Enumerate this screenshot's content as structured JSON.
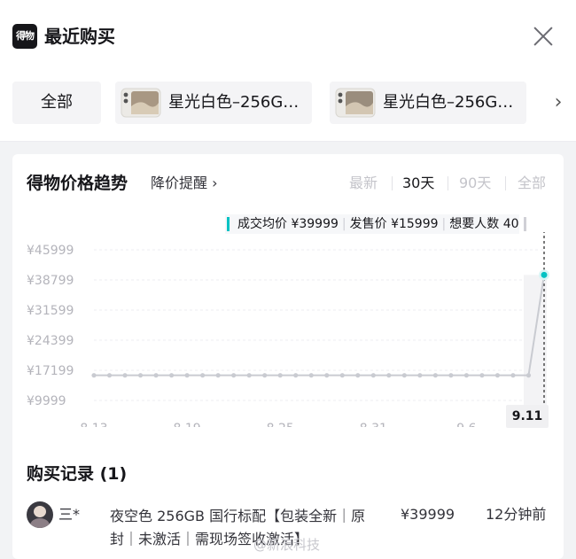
{
  "header": {
    "logo_text": "得物",
    "title": "最近购买"
  },
  "tabs": {
    "all_label": "全部",
    "products": [
      {
        "label": "星光白色–256G…"
      },
      {
        "label": "星光白色–256G…"
      }
    ]
  },
  "trend": {
    "title": "得物价格趋势",
    "price_alert_label": "降价提醒 ›",
    "ranges": [
      "最新",
      "30天",
      "90天",
      "全部"
    ],
    "active_range": "30天",
    "stats": {
      "avg_deal_label": "成交均价 ¥39999",
      "launch_price_label": "发售价 ¥15999",
      "wanted_label": "想要人数 40"
    }
  },
  "chart_data": {
    "type": "line",
    "y_ticks": [
      "¥45999",
      "¥38799",
      "¥31599",
      "¥24399",
      "¥17199",
      "¥9999"
    ],
    "x_ticks": [
      "8.13",
      "8.19",
      "8.25",
      "8.31",
      "9.6",
      "9.11"
    ],
    "ylim": [
      9999,
      45999
    ],
    "x": [
      "8.13",
      "8.14",
      "8.15",
      "8.16",
      "8.17",
      "8.18",
      "8.19",
      "8.20",
      "8.21",
      "8.22",
      "8.23",
      "8.24",
      "8.25",
      "8.26",
      "8.27",
      "8.28",
      "8.29",
      "8.30",
      "8.31",
      "9.1",
      "9.2",
      "9.3",
      "9.4",
      "9.5",
      "9.6",
      "9.7",
      "9.8",
      "9.9",
      "9.10",
      "9.11"
    ],
    "values": [
      15999,
      15999,
      15999,
      15999,
      15999,
      15999,
      15999,
      15999,
      15999,
      15999,
      15999,
      15999,
      15999,
      15999,
      15999,
      15999,
      15999,
      15999,
      15999,
      15999,
      15999,
      15999,
      15999,
      15999,
      15999,
      15999,
      15999,
      15999,
      15999,
      39999
    ],
    "highlighted_x": "9.11",
    "colors": {
      "line": "#c9cbd1",
      "point": "#c9cbd1",
      "highlight": "#01c2c3"
    },
    "grid": true
  },
  "records": {
    "title": "购买记录 (1)",
    "items": [
      {
        "buyer": "三*",
        "desc": "夜空色 256GB 国行标配【包装全新｜原封｜未激活｜需现场签收激活】",
        "price": "¥39999",
        "time": "12分钟前"
      }
    ]
  },
  "watermark": "@新浪科技"
}
